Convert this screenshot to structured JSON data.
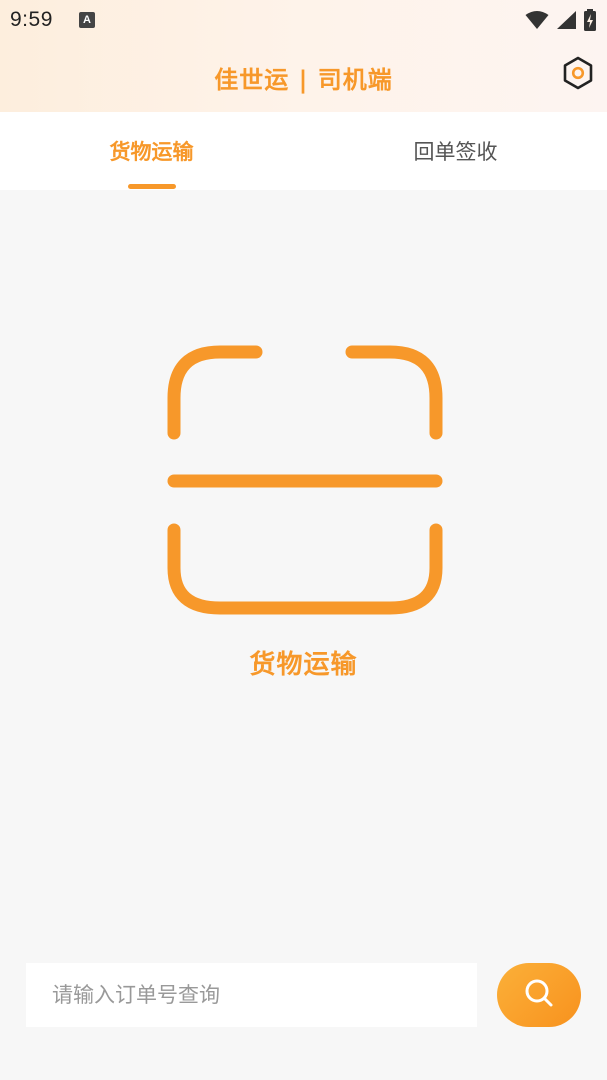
{
  "status_bar": {
    "time": "9:59",
    "notification_icon_letter": "A",
    "icons": [
      "wifi-icon",
      "signal-icon",
      "battery-icon"
    ]
  },
  "header": {
    "title": "佳世运 | 司机端",
    "settings_icon": "settings-hexagon-icon"
  },
  "tabs": [
    {
      "label": "货物运输",
      "active": true
    },
    {
      "label": "回单签收",
      "active": false
    }
  ],
  "scan": {
    "icon": "scan-frame-icon",
    "label": "货物运输"
  },
  "search": {
    "placeholder": "请输入订单号查询",
    "value": "",
    "button_icon": "search-icon"
  },
  "colors": {
    "accent": "#f7982a",
    "background": "#f7f7f7",
    "tab_inactive_text": "#555555"
  }
}
